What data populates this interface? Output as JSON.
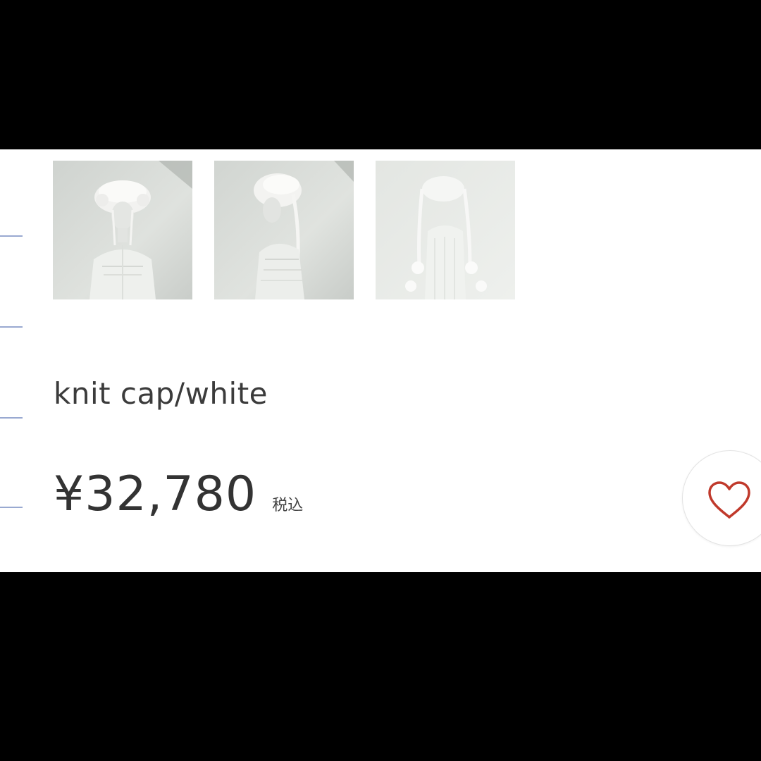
{
  "product": {
    "title": "knit cap/white",
    "price": "¥32,780",
    "tax_label": "税込"
  },
  "thumbnails": [
    {
      "icon": "product-photo-front"
    },
    {
      "icon": "product-photo-side"
    },
    {
      "icon": "product-photo-back"
    }
  ],
  "favorite": {
    "icon": "heart-icon",
    "color": "#c0392b"
  },
  "colors": {
    "background": "#000000",
    "panel": "#ffffff",
    "text": "#333333",
    "heart": "#c0392b"
  }
}
